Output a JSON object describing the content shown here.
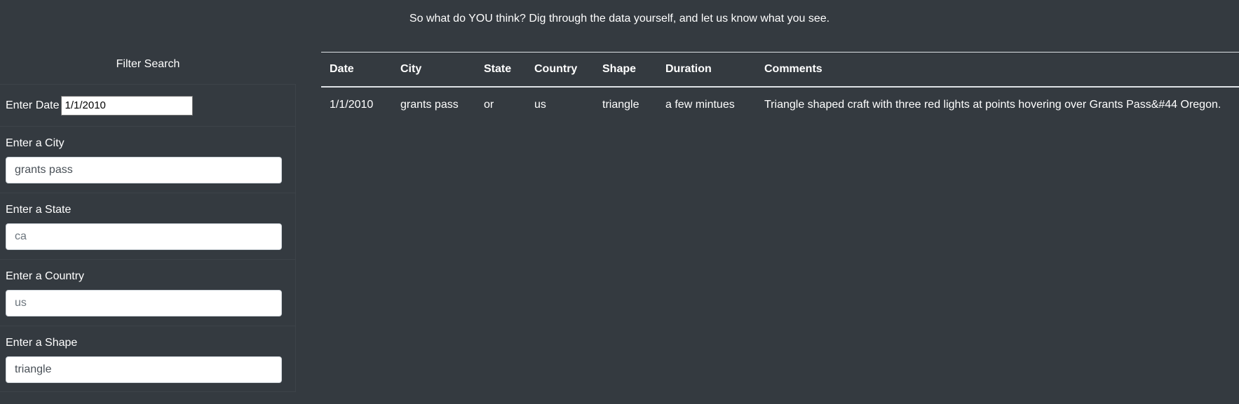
{
  "intro": "So what do YOU think? Dig through the data yourself, and let us know what you see.",
  "filter": {
    "title": "Filter Search",
    "date": {
      "label": "Enter Date",
      "value": "1/1/2010"
    },
    "city": {
      "label": "Enter a City",
      "value": "grants pass"
    },
    "state": {
      "label": "Enter a State",
      "placeholder": "ca"
    },
    "country": {
      "label": "Enter a Country",
      "placeholder": "us"
    },
    "shape": {
      "label": "Enter a Shape",
      "value": "triangle"
    }
  },
  "table": {
    "headers": [
      "Date",
      "City",
      "State",
      "Country",
      "Shape",
      "Duration",
      "Comments"
    ],
    "rows": [
      [
        "1/1/2010",
        "grants pass",
        "or",
        "us",
        "triangle",
        "a few mintues",
        "Triangle shaped craft with three red lights at points hovering over Grants Pass&#44 Oregon."
      ]
    ]
  }
}
